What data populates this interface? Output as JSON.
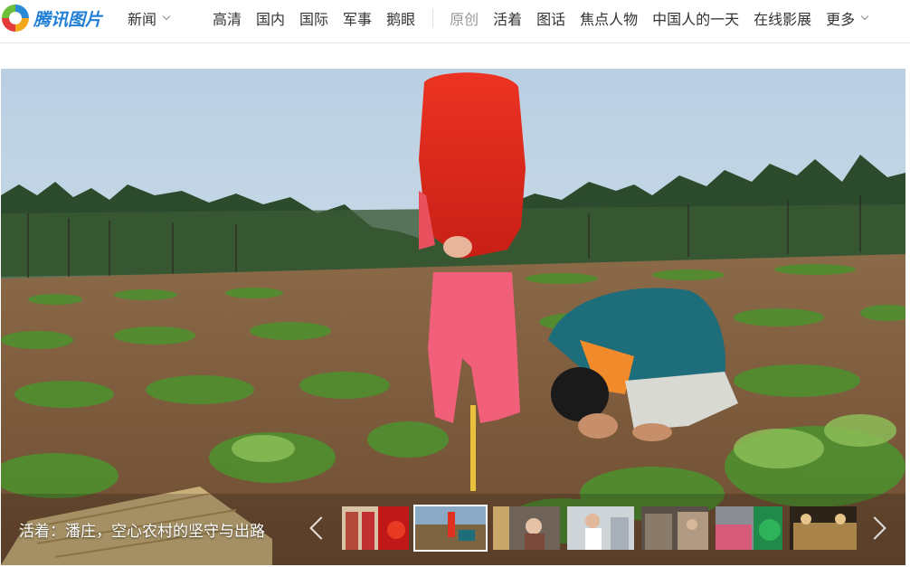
{
  "site": {
    "logo_text": "腾讯图片",
    "channel": "新闻"
  },
  "nav": {
    "left": [
      "高清",
      "国内",
      "国际",
      "军事",
      "鹅眼"
    ],
    "original": "原创",
    "right": [
      "活着",
      "图话",
      "焦点人物",
      "中国人的一天",
      "在线影展",
      "更多"
    ]
  },
  "hero": {
    "caption": "活着：潘庄，空心农村的坚守与出路",
    "colors": {
      "sky": "#c7d8e8",
      "field": "#7a5a3c",
      "veil": "#e02a1e",
      "pants": "#f2607a",
      "jacket": "#1e6d7a"
    }
  }
}
